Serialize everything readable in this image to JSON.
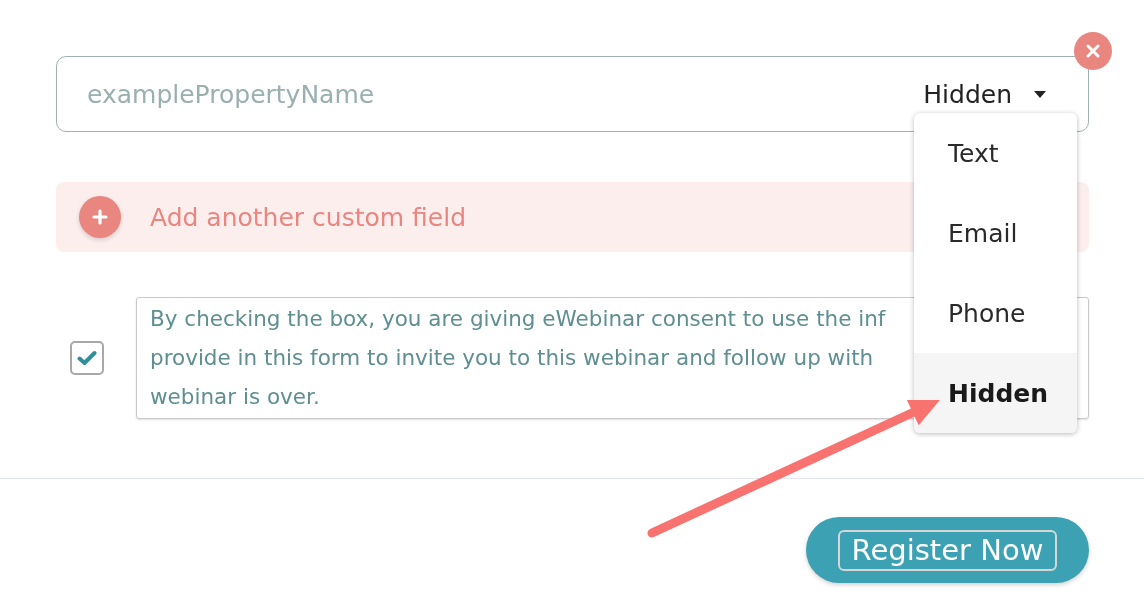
{
  "custom_field": {
    "placeholder": "examplePropertyName",
    "type_select": {
      "value": "Hidden",
      "expanded": true,
      "options": [
        {
          "label": "Text",
          "selected": false
        },
        {
          "label": "Email",
          "selected": false
        },
        {
          "label": "Phone",
          "selected": false
        },
        {
          "label": "Hidden",
          "selected": true
        }
      ]
    }
  },
  "add_field_button": {
    "label": "Add another custom field"
  },
  "consent": {
    "checked": true,
    "lines": [
      "By checking the box, you are giving eWebinar consent to use the inf",
      "provide in this form to invite you to this webinar and follow up with",
      "webinar is over."
    ]
  },
  "register_button": {
    "label": "Register Now",
    "focused": true
  }
}
